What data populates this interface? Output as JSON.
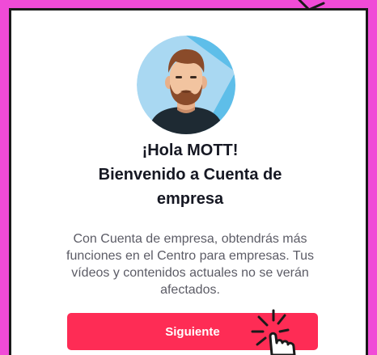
{
  "greeting": "¡Hola MOTT!",
  "welcome_line1": "Bienvenido a Cuenta de",
  "welcome_line2": "empresa",
  "description": "Con Cuenta de empresa, obtendrás más funciones en el Centro para empresas. Tus vídeos y contenidos actuales no se verán afectados.",
  "next_button_label": "Siguiente",
  "icons": {
    "avatar": "user-avatar-illustration",
    "pointer": "hand-pointer-icon",
    "corner": "arrow-decoration"
  },
  "colors": {
    "background": "#f04bd7",
    "primary_button": "#fe2c55",
    "title_text": "#161823",
    "body_text": "#5c5c66"
  }
}
